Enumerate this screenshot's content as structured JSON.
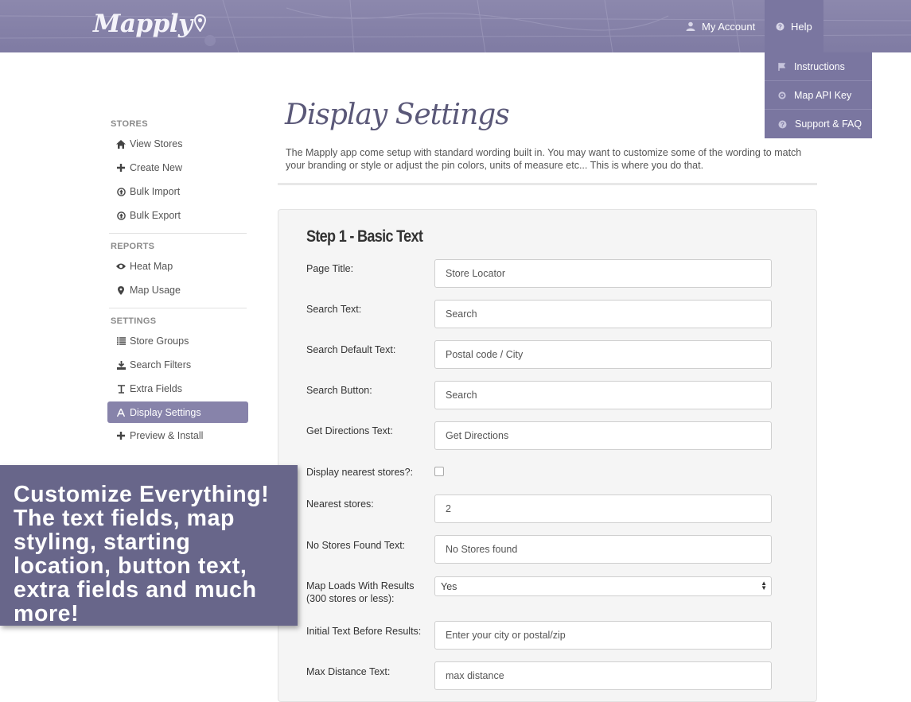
{
  "header": {
    "logo_text": "Mapply",
    "account_label": "My Account",
    "help_label": "Help"
  },
  "help_menu": [
    {
      "label": "Instructions",
      "icon": "flag-icon"
    },
    {
      "label": "Map API Key",
      "icon": "gear-icon"
    },
    {
      "label": "Support & FAQ",
      "icon": "question-icon"
    }
  ],
  "sidebar": {
    "stores_heading": "STORES",
    "stores_items": [
      {
        "label": "View Stores",
        "icon": "home-icon"
      },
      {
        "label": "Create New",
        "icon": "plus-icon"
      },
      {
        "label": "Bulk Import",
        "icon": "circle-arrow-icon"
      },
      {
        "label": "Bulk Export",
        "icon": "circle-arrow-icon"
      }
    ],
    "reports_heading": "REPORTS",
    "reports_items": [
      {
        "label": "Heat Map",
        "icon": "eye-icon"
      },
      {
        "label": "Map Usage",
        "icon": "map-marker-icon"
      }
    ],
    "settings_heading": "SETTINGS",
    "settings_items": [
      {
        "label": "Store Groups",
        "icon": "list-icon"
      },
      {
        "label": "Search Filters",
        "icon": "download-icon"
      },
      {
        "label": "Extra Fields",
        "icon": "text-height-icon"
      },
      {
        "label": "Display Settings",
        "icon": "font-icon",
        "active": true
      },
      {
        "label": "Preview & Install",
        "icon": "plus-icon"
      }
    ]
  },
  "main": {
    "title": "Display Settings",
    "intro": "The Mapply app come setup with standard wording built in. You may want to customize some of the wording to match your branding or style or adjust the pin colors, units of measure etc... This is where you do that.",
    "step_title": "Step 1 - Basic Text",
    "fields": {
      "page_title": {
        "label": "Page Title:",
        "value": "Store Locator"
      },
      "search_text": {
        "label": "Search Text:",
        "value": "Search"
      },
      "search_default": {
        "label": "Search Default Text:",
        "value": "Postal code / City"
      },
      "search_button": {
        "label": "Search Button:",
        "value": "Search"
      },
      "directions": {
        "label": "Get Directions Text:",
        "value": "Get Directions"
      },
      "display_nearest": {
        "label": "Display nearest stores?:",
        "checked": false
      },
      "nearest": {
        "label": "Nearest stores:",
        "value": "2"
      },
      "no_stores": {
        "label": "No Stores Found Text:",
        "value": "No Stores found"
      },
      "map_loads": {
        "label": "Map Loads With Results (300 stores or less):",
        "value": "Yes"
      },
      "initial_text": {
        "label": "Initial Text Before Results:",
        "value": "Enter your city or postal/zip"
      },
      "max_distance": {
        "label": "Max Distance Text:",
        "value": "max distance"
      }
    }
  },
  "promo": {
    "text": "Customize Everything! The text fields, map styling, starting location, button text, extra fields and much more!"
  },
  "colors": {
    "header_bg": "#817da4",
    "accent": "#8783aa",
    "promo_bg": "#68668a"
  }
}
